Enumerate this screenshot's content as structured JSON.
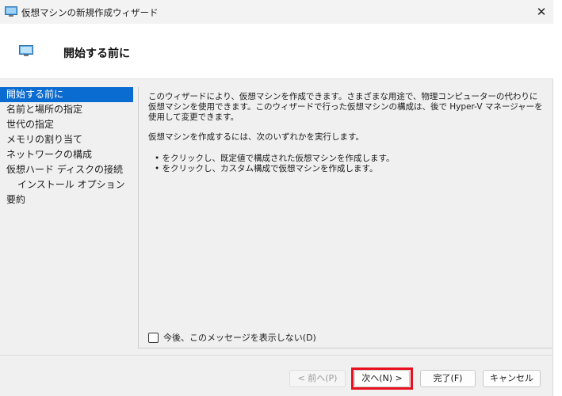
{
  "window": {
    "title": "仮想マシンの新規作成ウィザード",
    "close_glyph": "✕"
  },
  "header": {
    "title": "開始する前に"
  },
  "nav": {
    "items": [
      {
        "label": "開始する前に",
        "selected": true
      },
      {
        "label": "名前と場所の指定"
      },
      {
        "label": "世代の指定"
      },
      {
        "label": "メモリの割り当て"
      },
      {
        "label": "ネットワークの構成"
      },
      {
        "label": "仮想ハード ディスクの接続"
      },
      {
        "label": "インストール オプション",
        "indent": true
      },
      {
        "label": "要約"
      }
    ]
  },
  "content": {
    "paragraph1": "このウィザードにより、仮想マシンを作成できます。さまざまな用途で、物理コンピューターの代わりに仮想マシンを使用できます。このウィザードで行った仮想マシンの構成は、後で Hyper-V マネージャーを使用して変更できます。",
    "paragraph2": "仮想マシンを作成するには、次のいずれかを実行します。",
    "bullets": [
      "• をクリックし、既定値で構成された仮想マシンを作成します。",
      "• をクリックし、カスタム構成で仮想マシンを作成します。"
    ],
    "checkbox_label": "今後、このメッセージを表示しない(D)"
  },
  "buttons": {
    "back": "< 前へ(P)",
    "next": "次へ(N) >",
    "finish": "完了(F)",
    "cancel": "キャンセル"
  },
  "colors": {
    "selection": "#0a6bd0",
    "highlight_border": "#e8101f"
  },
  "icons": {
    "title": "vm-monitor-icon",
    "header": "vm-monitor-icon"
  }
}
